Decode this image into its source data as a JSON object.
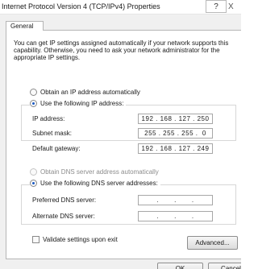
{
  "window": {
    "title": "Internet Protocol Version 4 (TCP/IPv4) Properties",
    "help_glyph": "?",
    "close_glyph": "X"
  },
  "tabs": [
    {
      "label": "General"
    }
  ],
  "intro_text": "You can get IP settings assigned automatically if your network supports this capability. Otherwise, you need to ask your network administrator for the appropriate IP settings.",
  "ip": {
    "auto_label": "Obtain an IP address automatically",
    "manual_label": "Use the following IP address:",
    "fields": [
      {
        "label": "IP address:",
        "value": "192 . 168 . 127 . 250"
      },
      {
        "label": "Subnet mask:",
        "value": "255 . 255 . 255 .  0"
      },
      {
        "label": "Default gateway:",
        "value": "192 . 168 . 127 . 249"
      }
    ]
  },
  "dns": {
    "auto_label": "Obtain DNS server address automatically",
    "manual_label": "Use the following DNS server addresses:",
    "fields": [
      {
        "label": "Preferred DNS server:",
        "value": ".       .       ."
      },
      {
        "label": "Alternate DNS server:",
        "value": ".       .       ."
      }
    ]
  },
  "validate_label": "Validate settings upon exit",
  "advanced_label": "Advanced...",
  "footer": {
    "ok_label": "OK",
    "cancel_label": "Cancel"
  }
}
